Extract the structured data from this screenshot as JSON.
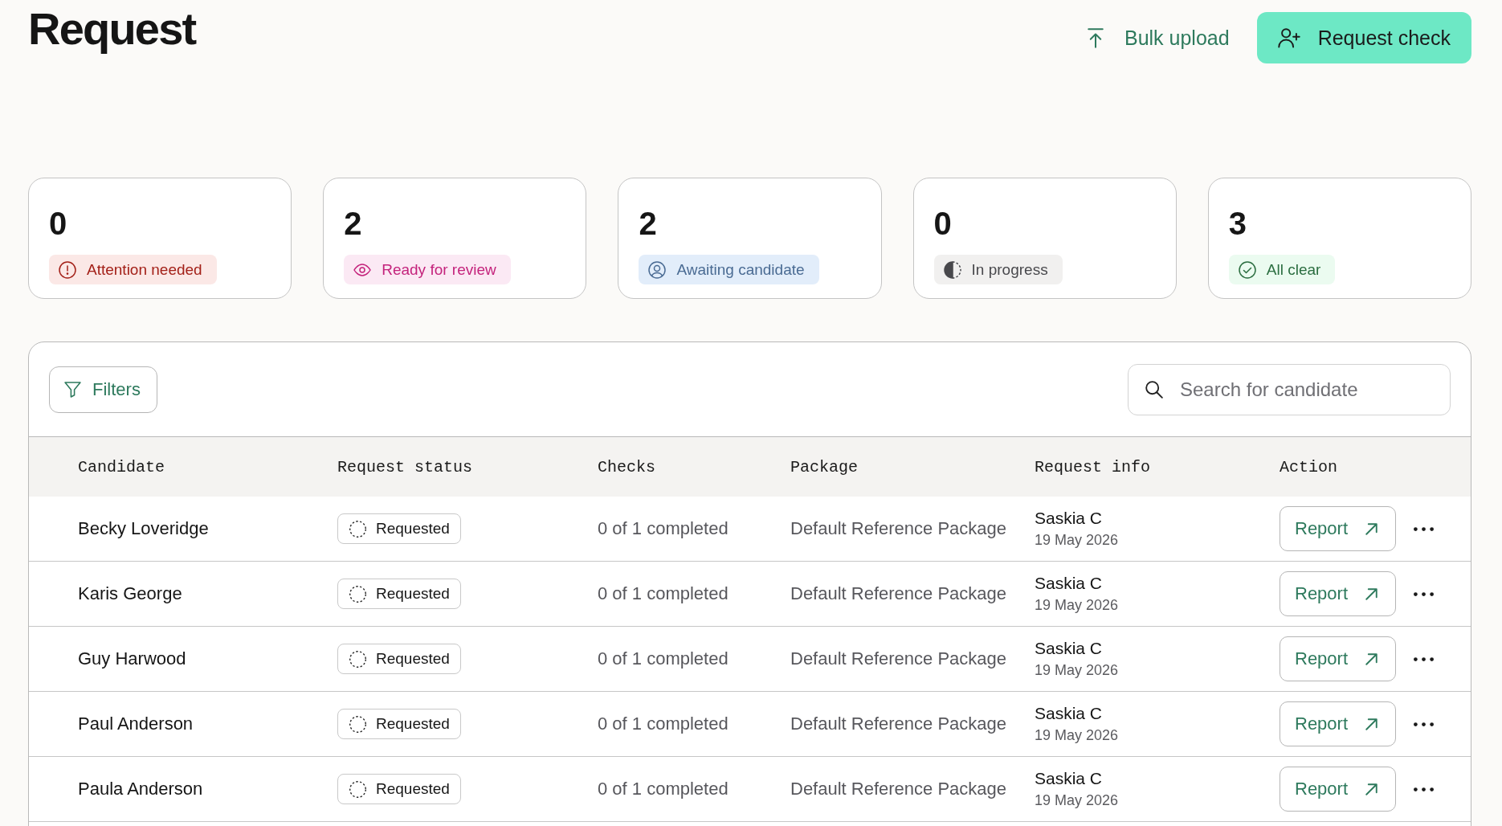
{
  "page": {
    "title": "Request"
  },
  "header_actions": {
    "bulk_upload": "Bulk upload",
    "request_check": "Request check"
  },
  "summary_cards": [
    {
      "count": "0",
      "label": "Attention needed",
      "kind": "attention",
      "color": "#a32018"
    },
    {
      "count": "2",
      "label": "Ready for review",
      "kind": "review",
      "color": "#c4237c"
    },
    {
      "count": "2",
      "label": "Awaiting candidate",
      "kind": "awaiting",
      "color": "#4a6b93"
    },
    {
      "count": "0",
      "label": "In progress",
      "kind": "progress",
      "color": "#48484c"
    },
    {
      "count": "3",
      "label": "All clear",
      "kind": "clear",
      "color": "#2b6e40"
    }
  ],
  "requests_table": {
    "filters_button": "Filters",
    "search": {
      "placeholder": "Search for candidate"
    },
    "columns": [
      "Candidate",
      "Request status",
      "Checks",
      "Package",
      "Request info",
      "Action"
    ],
    "rows": [
      {
        "candidate": "Becky Loveridge",
        "status": "Requested",
        "checks": "0 of 1 completed",
        "package": "Default Reference Package",
        "requested_by": "Saskia C",
        "requested_on": "19 May 2026",
        "action": "Report"
      },
      {
        "candidate": "Karis George",
        "status": "Requested",
        "checks": "0 of 1 completed",
        "package": "Default Reference Package",
        "requested_by": "Saskia C",
        "requested_on": "19 May 2026",
        "action": "Report"
      },
      {
        "candidate": "Guy Harwood",
        "status": "Requested",
        "checks": "0 of 1 completed",
        "package": "Default Reference Package",
        "requested_by": "Saskia C",
        "requested_on": "19 May 2026",
        "action": "Report"
      },
      {
        "candidate": "Paul Anderson",
        "status": "Requested",
        "checks": "0 of 1 completed",
        "package": "Default Reference Package",
        "requested_by": "Saskia C",
        "requested_on": "19 May 2026",
        "action": "Report"
      },
      {
        "candidate": "Paula Anderson",
        "status": "Requested",
        "checks": "0 of 1 completed",
        "package": "Default Reference Package",
        "requested_by": "Saskia C",
        "requested_on": "19 May 2026",
        "action": "Report"
      }
    ]
  }
}
